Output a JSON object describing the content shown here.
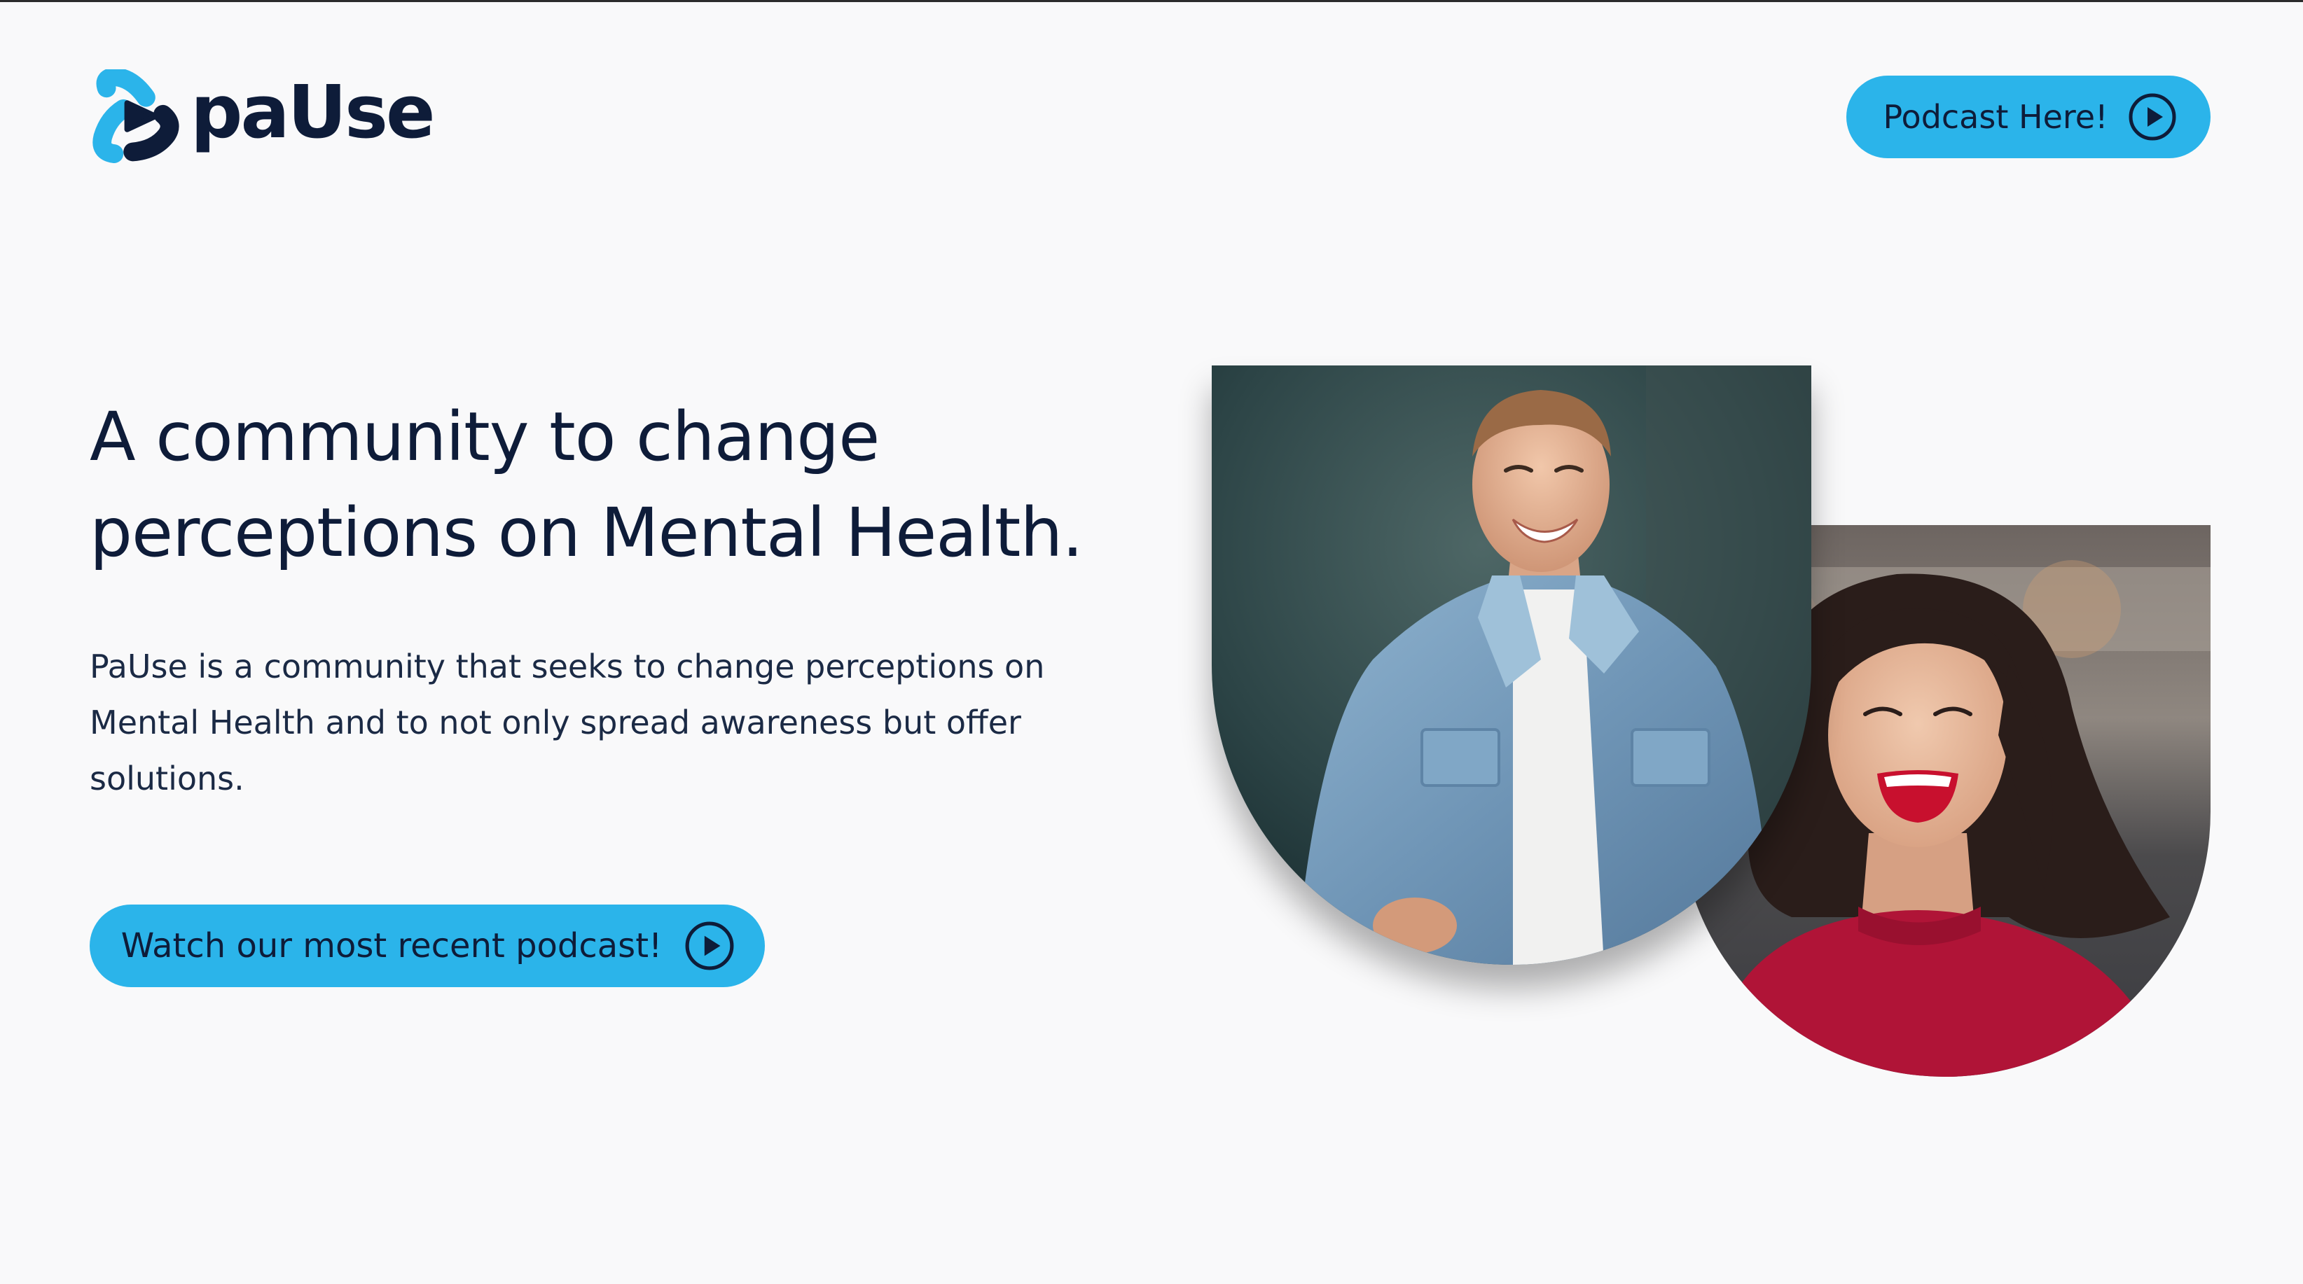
{
  "brand": {
    "name": "paUse",
    "primary_color": "#2bb4ea",
    "text_color": "#0e1c39",
    "background": "#f9f9fa"
  },
  "header": {
    "podcast_button_label": "Podcast Here!",
    "podcast_button_icon": "play-circle-icon"
  },
  "hero": {
    "title_line1": "A community to change",
    "title_line2": "perceptions on Mental Health.",
    "description": "PaUse is a community that seeks to change perceptions on Mental Health and to not only spread awareness but offer solutions.",
    "cta_label": "Watch our most recent podcast!",
    "cta_icon": "play-circle-icon"
  },
  "photos": [
    {
      "subject": "smiling-man-in-denim-jacket"
    },
    {
      "subject": "laughing-woman-in-red-top"
    }
  ]
}
